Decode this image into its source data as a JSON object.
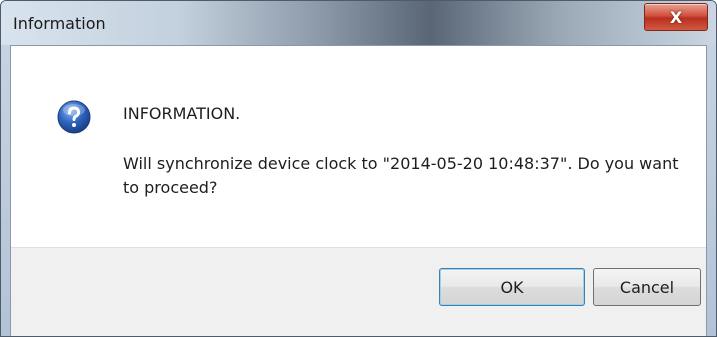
{
  "window": {
    "title": "Information",
    "close_glyph": "X"
  },
  "dialog": {
    "icon": "question-icon",
    "heading": "INFORMATION.",
    "message": "Will synchronize device clock to \"2014-05-20 10:48:37\". Do you want to proceed?"
  },
  "buttons": {
    "ok_label": "OK",
    "cancel_label": "Cancel"
  },
  "colors": {
    "close_button": "#c8402c",
    "icon_blue": "#2a5fb5",
    "button_area": "#f0f0f0"
  }
}
